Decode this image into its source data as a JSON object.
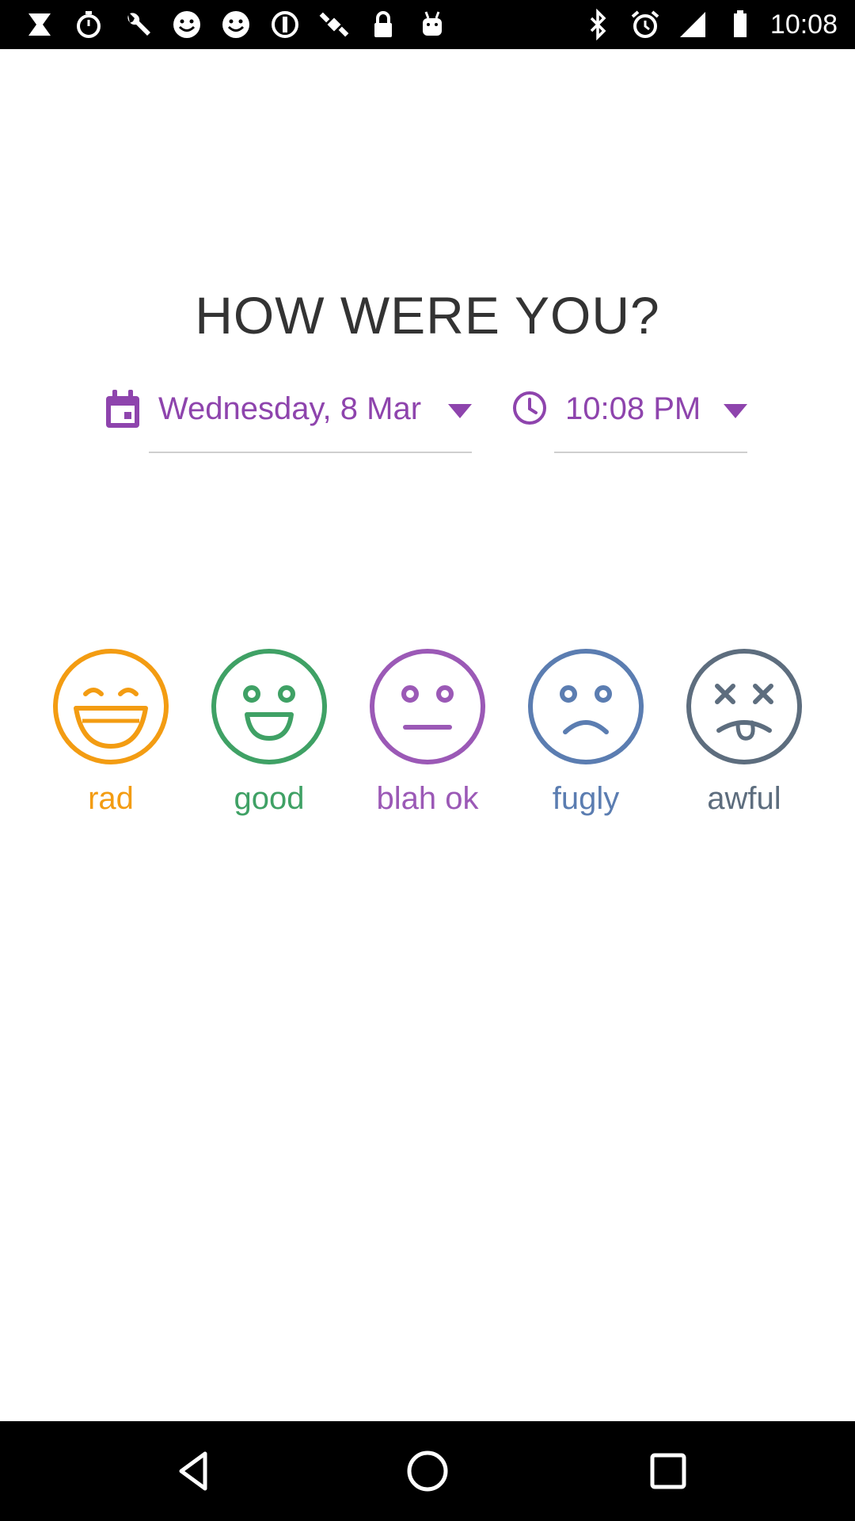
{
  "status_bar": {
    "time": "10:08",
    "left_icons": [
      "x-icon",
      "stopwatch-icon",
      "wrench-icon",
      "smiley-icon",
      "smiley-icon",
      "info-icon",
      "satellite-icon",
      "lock-icon",
      "android-icon"
    ],
    "right_icons": [
      "bluetooth-icon",
      "alarm-icon",
      "signal-icon",
      "battery-icon"
    ]
  },
  "title": "HOW WERE YOU?",
  "date_picker": {
    "value": "Wednesday, 8 Mar",
    "icon": "calendar-icon"
  },
  "time_picker": {
    "value": "10:08 PM",
    "icon": "clock-icon"
  },
  "moods": [
    {
      "id": "rad",
      "label": "rad",
      "color": "#f39c12"
    },
    {
      "id": "good",
      "label": "good",
      "color": "#3fa165"
    },
    {
      "id": "blah-ok",
      "label": "blah ok",
      "color": "#9b59b6"
    },
    {
      "id": "fugly",
      "label": "fugly",
      "color": "#5b7db1"
    },
    {
      "id": "awful",
      "label": "awful",
      "color": "#5d6d7e"
    }
  ],
  "accent_color": "#8e44ad",
  "nav_bar": {
    "buttons": [
      "back-icon",
      "home-icon",
      "recents-icon"
    ]
  }
}
